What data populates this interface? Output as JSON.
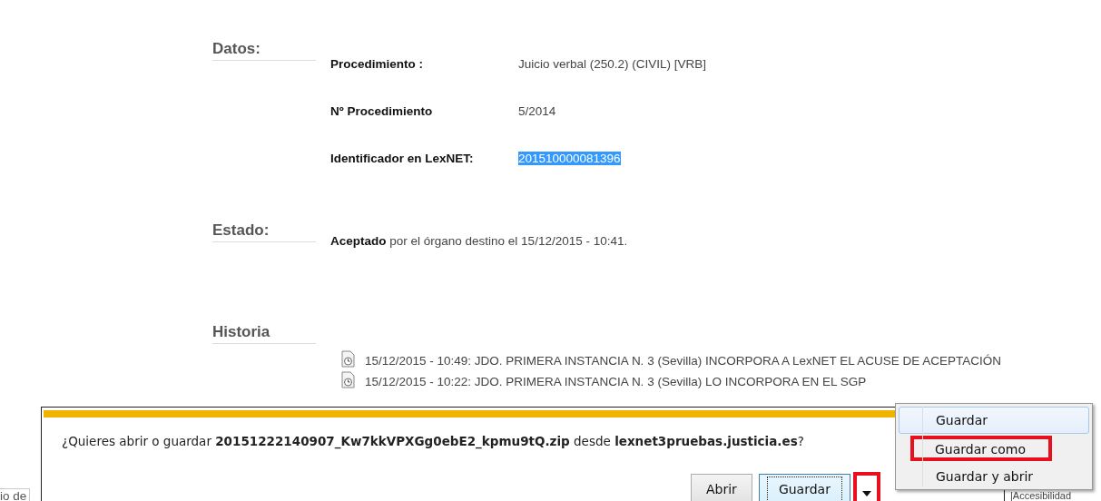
{
  "sections": [
    {
      "kind": "fields",
      "heading": "Datos:",
      "rows": [
        {
          "label": "Procedimiento :",
          "value": "Juicio verbal (250.2) (CIVIL) [VRB]",
          "selected": false
        },
        {
          "label": "Nº Procedimiento",
          "value": "5/2014",
          "selected": false
        },
        {
          "label": "Identificador en LexNET:",
          "value": "201510000081396",
          "selected": true
        }
      ]
    },
    {
      "kind": "text",
      "heading": "Estado:",
      "text": "**Aceptado** por el órgano destino el 15/12/2015 - 10:41."
    },
    {
      "kind": "history",
      "heading": "Historia",
      "items": [
        "15/12/2015 - 10:49: JDO. PRIMERA INSTANCIA N. 3 (Sevilla) INCORPORA A LexNET EL ACUSE DE ACEPTACIÓN",
        "15/12/2015 - 10:22: JDO. PRIMERA INSTANCIA N. 3 (Sevilla) LO INCORPORA EN EL SGP"
      ]
    }
  ],
  "footer": {
    "left": "io de",
    "right": "|Accesibilidad"
  },
  "download_bar": {
    "message": "¿Quieres abrir o guardar **20151222140907_Kw7kkVPXGg0ebE2_kpmu9tQ.zip** desde **lexnet3pruebas.justicia.es**?",
    "buttons": [
      {
        "label": "Abrir",
        "focused": false
      },
      {
        "label": "Guardar",
        "focused": true
      }
    ],
    "dropdown": {
      "highlighted": true
    }
  },
  "menu": [
    {
      "label": "Guardar",
      "selected": true,
      "highlighted": false
    },
    {
      "label": "Guardar como",
      "selected": false,
      "highlighted": true
    },
    {
      "label": "Guardar y abrir",
      "selected": false,
      "highlighted": false
    }
  ]
}
